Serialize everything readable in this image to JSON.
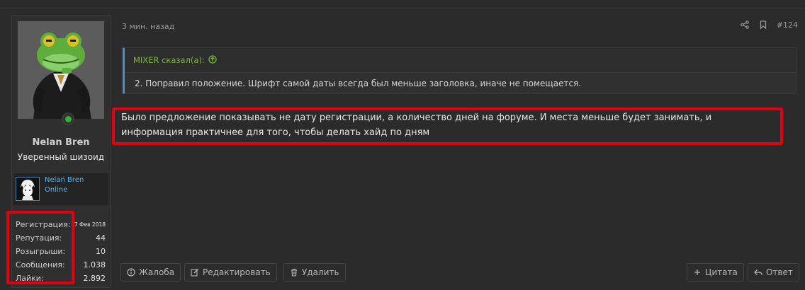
{
  "post": {
    "time": "3 мин. назад",
    "number": "#124",
    "quote": {
      "author_line": "MIXER сказал(а):",
      "text": "2. Поправил положение. Шрифт самой даты всегда был меньше заголовка, иначе не помещается."
    },
    "message": "Было предложение показывать не дату регистрации, а количество дней на форуме. И места меньше будет занимать, и информация практичнее для того, чтобы делать хайд по дням"
  },
  "user": {
    "name": "Nelan Bren",
    "title": "Уверенный шизоид",
    "mini_card": {
      "name": "Nelan Bren",
      "status": "Online"
    },
    "stats": [
      {
        "label": "Регистрация:",
        "value": "7 Фев 2018"
      },
      {
        "label": "Репутация:",
        "value": "44"
      },
      {
        "label": "Розыгрыши:",
        "value": "10"
      },
      {
        "label": "Сообщения:",
        "value": "1.038"
      },
      {
        "label": "Лайки:",
        "value": "2.892"
      }
    ]
  },
  "actions": {
    "report": "Жалоба",
    "edit": "Редактировать",
    "delete": "Удалить",
    "quote": "Цитата",
    "reply": "Ответ"
  },
  "icons": {
    "share": "share-icon",
    "bookmark": "bookmark-icon",
    "arrow_up": "arrow-up-circle-icon",
    "report": "info-circle-icon",
    "edit": "pencil-icon",
    "delete": "trash-icon",
    "quote": "plus-icon",
    "reply": "reply-arrow-icon"
  },
  "colors": {
    "background": "#2b2b2b",
    "accent_blue": "#4a8fd0",
    "quote_author": "#79b93c",
    "online": "#3cae3c",
    "highlight_red": "#e3000f",
    "link": "#5eb4e6"
  }
}
